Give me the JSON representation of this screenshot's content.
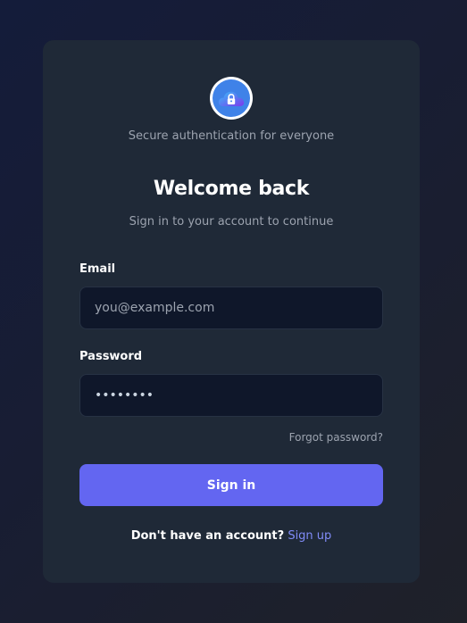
{
  "brand": {
    "icon": "cloud-lock-icon",
    "tagline": "Secure authentication for everyone"
  },
  "heading": {
    "title": "Welcome back",
    "subtitle": "Sign in to your account to continue"
  },
  "form": {
    "email_label": "Email",
    "email_placeholder": "you@example.com",
    "email_value": "",
    "password_label": "Password",
    "password_value": "••••••••",
    "forgot_link": "Forgot password?",
    "submit_label": "Sign in"
  },
  "footer": {
    "prompt": "Don't have an account?",
    "signup_link": "Sign up"
  },
  "colors": {
    "accent": "#6366f1",
    "link": "#818cf8",
    "card": "#1f2937",
    "input_bg": "#0f172a"
  }
}
